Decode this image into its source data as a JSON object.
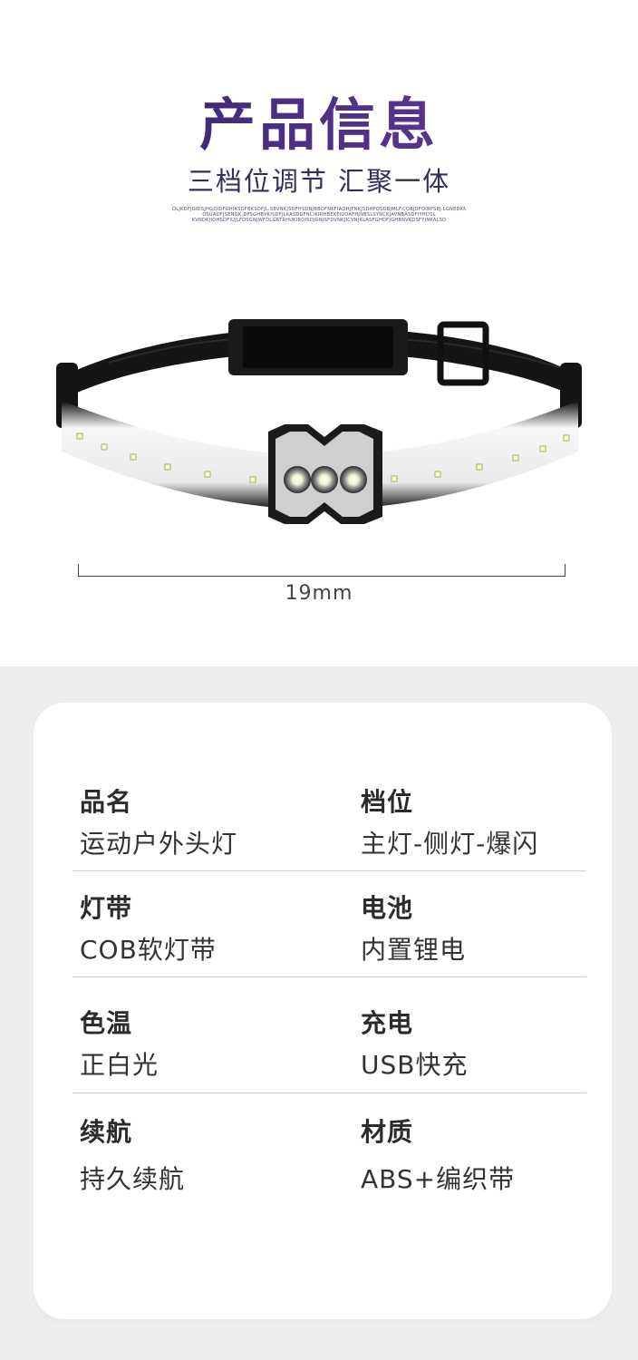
{
  "header": {
    "title": "产品信息",
    "subtitle": "三档位调节 汇聚一体",
    "fine_print": [
      "OLJKDFJGIDSJHGOIDFGHIKSDFBKSDFJL.SBVNKJSDFHSDNJBBDFNKFIAOHJFNKJSDHFOSDBJMLF.COBJDFOIRPSEJ.LGNEDKN",
      "OSUADFJSENGK,DFSGHBVKISDFJLKASDGFNCIKIRHBEKFIUOAFHJNBSLSYNCKJAVNBASDFIYHDSL",
      "KVNDKJIOHSDFIUJLFDSGNJWFDLGRTRHUKIROISDJGNJSFDVNKJICVNJKLASFGHDFJGHBNVKDSFYJNKALSD"
    ]
  },
  "dimension": {
    "label": "19mm"
  },
  "specs": [
    {
      "left": {
        "label": "品名",
        "value": "运动户外头灯"
      },
      "right": {
        "label": "档位",
        "value": "主灯-侧灯-爆闪"
      }
    },
    {
      "left": {
        "label": "灯带",
        "value": "COB软灯带"
      },
      "right": {
        "label": "电池",
        "value": "内置锂电"
      }
    },
    {
      "left": {
        "label": "色温",
        "value": "正白光"
      },
      "right": {
        "label": "充电",
        "value": "USB快充"
      }
    },
    {
      "left": {
        "label": "续航",
        "value": "持久续航"
      },
      "right": {
        "label": "材质",
        "value": "ABS+编织带"
      }
    }
  ],
  "colors": {
    "title": "#3c2c7a",
    "card_background": "#ffffff",
    "lower_background": "#eeeeee"
  }
}
